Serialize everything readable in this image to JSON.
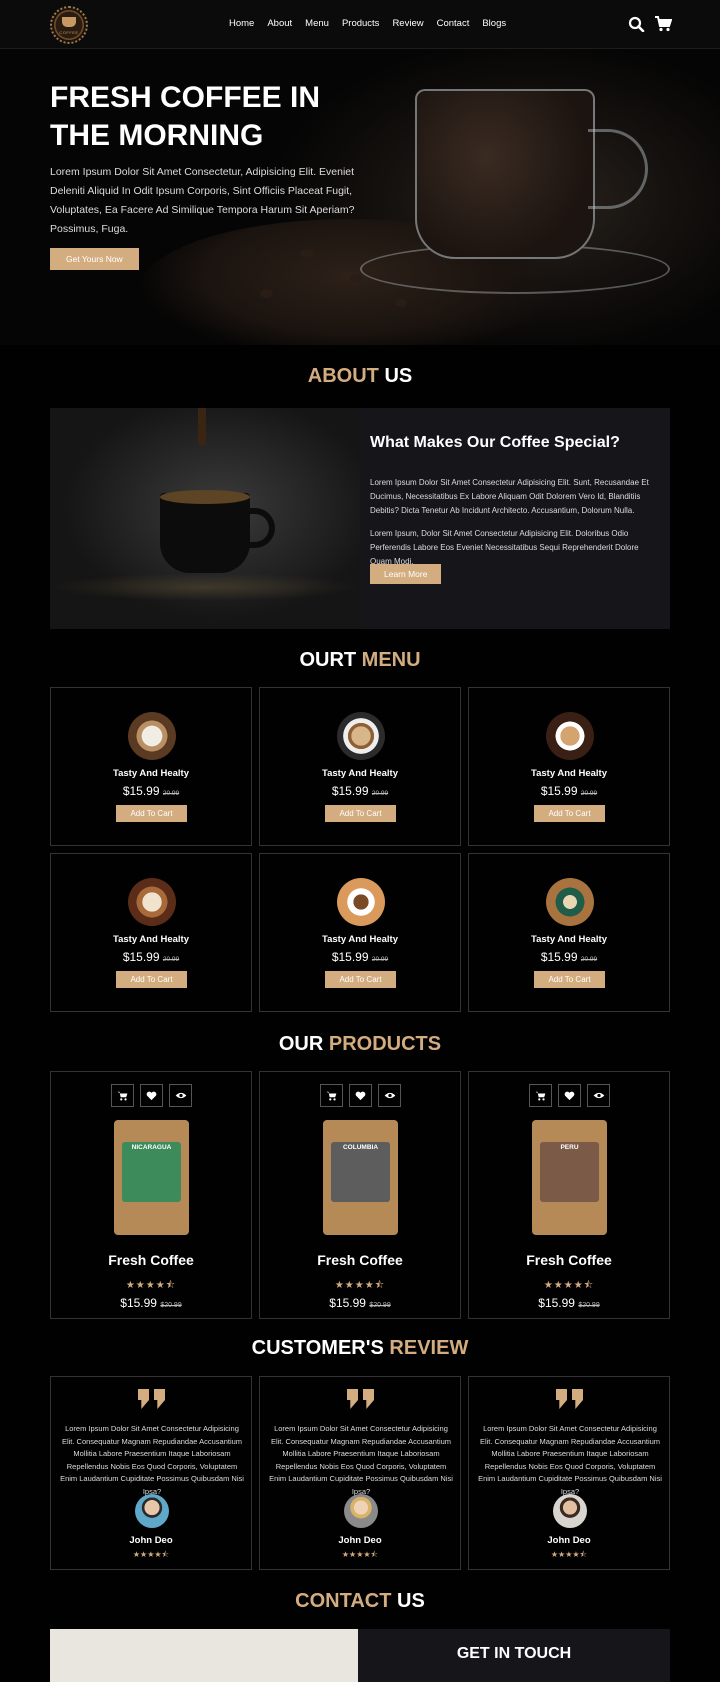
{
  "nav": {
    "items": [
      "Home",
      "About",
      "Menu",
      "Products",
      "Review",
      "Contact",
      "Blogs"
    ],
    "logo_text": "COFFEE"
  },
  "hero": {
    "title": "FRESH COFFEE IN THE MORNING",
    "text": "Lorem Ipsum Dolor Sit Amet Consectetur, Adipisicing Elit. Eveniet Deleniti Aliquid In Odit Ipsum Corporis, Sint Officiis Placeat Fugit, Voluptates, Ea Facere Ad Similique Tempora Harum Sit Aperiam? Possimus, Fuga.",
    "button": "Get Yours Now"
  },
  "about": {
    "title_accent": "ABOUT",
    "title_rest": "US",
    "heading": "What Makes Our Coffee Special?",
    "para1": "Lorem Ipsum Dolor Sit Amet Consectetur Adipisicing Elit. Sunt, Recusandae Et Ducimus, Necessitatibus Ex Labore Aliquam Odit Dolorem Vero Id, Blanditiis Debitis? Dicta Tenetur Ab Incidunt Architecto. Accusantium, Dolorum Nulla.",
    "para2": "Lorem Ipsum, Dolor Sit Amet Consectetur Adipisicing Elit. Doloribus Odio Perferendis Labore Eos Eveniet Necessitatibus Sequi Reprehenderit Dolore Quam Modi.",
    "button": "Learn More"
  },
  "menu": {
    "title_rest": "OURT",
    "title_accent": "MENU",
    "items": [
      {
        "name": "Tasty And Healty",
        "price": "$15.99",
        "old_price": "20.99",
        "button": "Add To Cart"
      },
      {
        "name": "Tasty And Healty",
        "price": "$15.99",
        "old_price": "20.99",
        "button": "Add To Cart"
      },
      {
        "name": "Tasty And Healty",
        "price": "$15.99",
        "old_price": "20.99",
        "button": "Add To Cart"
      },
      {
        "name": "Tasty And Healty",
        "price": "$15.99",
        "old_price": "20.99",
        "button": "Add To Cart"
      },
      {
        "name": "Tasty And Healty",
        "price": "$15.99",
        "old_price": "20.99",
        "button": "Add To Cart"
      },
      {
        "name": "Tasty And Healty",
        "price": "$15.99",
        "old_price": "20.99",
        "button": "Add To Cart"
      }
    ]
  },
  "products": {
    "title_rest": "OUR",
    "title_accent": "PRODUCTS",
    "items": [
      {
        "name": "Fresh Coffee",
        "stars": "★★★★⯪",
        "price": "$15.99",
        "old_price": "$20.99",
        "bag_label": "NICARAGUA",
        "bag_color": "#3d8a5a"
      },
      {
        "name": "Fresh Coffee",
        "stars": "★★★★⯪",
        "price": "$15.99",
        "old_price": "$20.99",
        "bag_label": "COLUMBIA",
        "bag_color": "#5d5d5d"
      },
      {
        "name": "Fresh Coffee",
        "stars": "★★★★⯪",
        "price": "$15.99",
        "old_price": "$20.99",
        "bag_label": "PERU",
        "bag_color": "#7b5a48"
      }
    ]
  },
  "review": {
    "title_rest": "CUSTOMER'S",
    "title_accent": "REVIEW",
    "items": [
      {
        "text": "Lorem Ipsum Dolor Sit Amet Consectetur Adipisicing Elit. Consequatur Magnam Repudiandae Accusantium Mollitia Labore Praesentium Itaque Laboriosam Repellendus Nobis Eos Quod Corporis, Voluptatem Enim Laudantium Cupiditate Possimus Quibusdam Nisi Ipsa?",
        "name": "John Deo",
        "stars": "★★★★⯪",
        "avatar_color": "#5fa8c9"
      },
      {
        "text": "Lorem Ipsum Dolor Sit Amet Consectetur Adipisicing Elit. Consequatur Magnam Repudiandae Accusantium Mollitia Labore Praesentium Itaque Laboriosam Repellendus Nobis Eos Quod Corporis, Voluptatem Enim Laudantium Cupiditate Possimus Quibusdam Nisi Ipsa?",
        "name": "John Deo",
        "stars": "★★★★⯪",
        "avatar_color": "#8a8a8a"
      },
      {
        "text": "Lorem Ipsum Dolor Sit Amet Consectetur Adipisicing Elit. Consequatur Magnam Repudiandae Accusantium Mollitia Labore Praesentium Itaque Laboriosam Repellendus Nobis Eos Quod Corporis, Voluptatem Enim Laudantium Cupiditate Possimus Quibusdam Nisi Ipsa?",
        "name": "John Deo",
        "stars": "★★★★⯪",
        "avatar_color": "#d8d4cf"
      }
    ]
  },
  "contact": {
    "title_accent": "CONTACT",
    "title_rest": "US",
    "form_title": "GET IN TOUCH"
  },
  "colors": {
    "accent": "#d3ad7f",
    "background": "#010101",
    "card_border": "#333333"
  }
}
